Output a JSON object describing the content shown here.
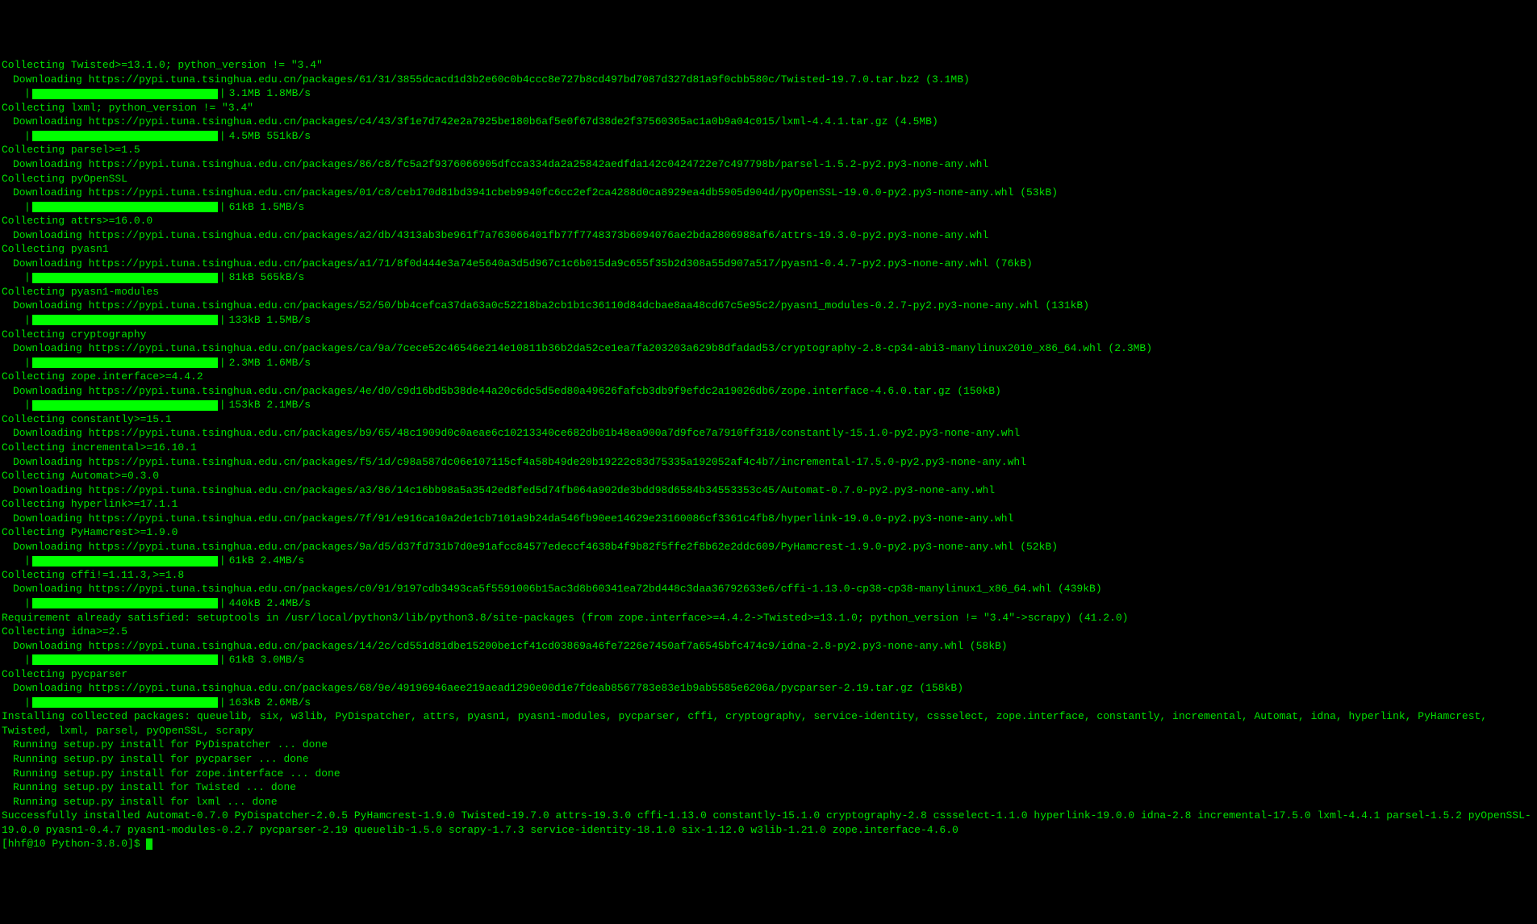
{
  "entries": [
    {
      "type": "collect",
      "text": "Collecting Twisted>=13.1.0; python_version != \"3.4\"",
      "download": "Downloading https://pypi.tuna.tsinghua.edu.cn/packages/61/31/3855dcacd1d3b2e60c0b4ccc8e727b8cd497bd7087d327d81a9f0cbb580c/Twisted-19.7.0.tar.bz2 (3.1MB)",
      "progress": "3.1MB 1.8MB/s",
      "blank_after": true
    },
    {
      "type": "collect",
      "text": "Collecting lxml; python_version != \"3.4\"",
      "download": "Downloading https://pypi.tuna.tsinghua.edu.cn/packages/c4/43/3f1e7d742e2a7925be180b6af5e0f67d38de2f37560365ac1a0b9a04c015/lxml-4.4.1.tar.gz (4.5MB)",
      "progress": "4.5MB 551kB/s"
    },
    {
      "type": "collect",
      "text": "Collecting parsel>=1.5",
      "download": "Downloading https://pypi.tuna.tsinghua.edu.cn/packages/86/c8/fc5a2f9376066905dfcca334da2a25842aedfda142c0424722e7c497798b/parsel-1.5.2-py2.py3-none-any.whl"
    },
    {
      "type": "collect",
      "text": "Collecting pyOpenSSL",
      "download": "Downloading https://pypi.tuna.tsinghua.edu.cn/packages/01/c8/ceb170d81bd3941cbeb9940fc6cc2ef2ca4288d0ca8929ea4db5905d904d/pyOpenSSL-19.0.0-py2.py3-none-any.whl (53kB)",
      "progress": "61kB 1.5MB/s"
    },
    {
      "type": "collect",
      "text": "Collecting attrs>=16.0.0",
      "download": "Downloading https://pypi.tuna.tsinghua.edu.cn/packages/a2/db/4313ab3be961f7a763066401fb77f7748373b6094076ae2bda2806988af6/attrs-19.3.0-py2.py3-none-any.whl"
    },
    {
      "type": "collect",
      "text": "Collecting pyasn1",
      "download": "Downloading https://pypi.tuna.tsinghua.edu.cn/packages/a1/71/8f0d444e3a74e5640a3d5d967c1c6b015da9c655f35b2d308a55d907a517/pyasn1-0.4.7-py2.py3-none-any.whl (76kB)",
      "progress": "81kB 565kB/s"
    },
    {
      "type": "collect",
      "text": "Collecting pyasn1-modules",
      "download": "Downloading https://pypi.tuna.tsinghua.edu.cn/packages/52/50/bb4cefca37da63a0c52218ba2cb1b1c36110d84dcbae8aa48cd67c5e95c2/pyasn1_modules-0.2.7-py2.py3-none-any.whl (131kB)",
      "progress": "133kB 1.5MB/s"
    },
    {
      "type": "collect",
      "text": "Collecting cryptography",
      "download": "Downloading https://pypi.tuna.tsinghua.edu.cn/packages/ca/9a/7cece52c46546e214e10811b36b2da52ce1ea7fa203203a629b8dfadad53/cryptography-2.8-cp34-abi3-manylinux2010_x86_64.whl (2.3MB)",
      "progress": "2.3MB 1.6MB/s"
    },
    {
      "type": "collect",
      "text": "Collecting zope.interface>=4.4.2",
      "download": "Downloading https://pypi.tuna.tsinghua.edu.cn/packages/4e/d0/c9d16bd5b38de44a20c6dc5d5ed80a49626fafcb3db9f9efdc2a19026db6/zope.interface-4.6.0.tar.gz (150kB)",
      "progress": "153kB 2.1MB/s"
    },
    {
      "type": "collect",
      "text": "Collecting constantly>=15.1",
      "download": "Downloading https://pypi.tuna.tsinghua.edu.cn/packages/b9/65/48c1909d0c0aeae6c10213340ce682db01b48ea900a7d9fce7a7910ff318/constantly-15.1.0-py2.py3-none-any.whl"
    },
    {
      "type": "collect",
      "text": "Collecting incremental>=16.10.1",
      "download": "Downloading https://pypi.tuna.tsinghua.edu.cn/packages/f5/1d/c98a587dc06e107115cf4a58b49de20b19222c83d75335a192052af4c4b7/incremental-17.5.0-py2.py3-none-any.whl"
    },
    {
      "type": "collect",
      "text": "Collecting Automat>=0.3.0",
      "download": "Downloading https://pypi.tuna.tsinghua.edu.cn/packages/a3/86/14c16bb98a5a3542ed8fed5d74fb064a902de3bdd98d6584b34553353c45/Automat-0.7.0-py2.py3-none-any.whl"
    },
    {
      "type": "collect",
      "text": "Collecting hyperlink>=17.1.1",
      "download": "Downloading https://pypi.tuna.tsinghua.edu.cn/packages/7f/91/e916ca10a2de1cb7101a9b24da546fb90ee14629e23160086cf3361c4fb8/hyperlink-19.0.0-py2.py3-none-any.whl"
    },
    {
      "type": "collect",
      "text": "Collecting PyHamcrest>=1.9.0",
      "download": "Downloading https://pypi.tuna.tsinghua.edu.cn/packages/9a/d5/d37fd731b7d0e91afcc84577edeccf4638b4f9b82f5ffe2f8b62e2ddc609/PyHamcrest-1.9.0-py2.py3-none-any.whl (52kB)",
      "progress": "61kB 2.4MB/s"
    },
    {
      "type": "collect",
      "text": "Collecting cffi!=1.11.3,>=1.8",
      "download": "Downloading https://pypi.tuna.tsinghua.edu.cn/packages/c0/91/9197cdb3493ca5f5591006b15ac3d8b60341ea72bd448c3daa36792633e6/cffi-1.13.0-cp38-cp38-manylinux1_x86_64.whl (439kB)",
      "progress": "440kB 2.4MB/s"
    },
    {
      "type": "plain",
      "text": "Requirement already satisfied: setuptools in /usr/local/python3/lib/python3.8/site-packages (from zope.interface>=4.4.2->Twisted>=13.1.0; python_version != \"3.4\"->scrapy) (41.2.0)"
    },
    {
      "type": "collect",
      "text": "Collecting idna>=2.5",
      "download": "Downloading https://pypi.tuna.tsinghua.edu.cn/packages/14/2c/cd551d81dbe15200be1cf41cd03869a46fe7226e7450af7a6545bfc474c9/idna-2.8-py2.py3-none-any.whl (58kB)",
      "progress": "61kB 3.0MB/s"
    },
    {
      "type": "collect",
      "text": "Collecting pycparser",
      "download": "Downloading https://pypi.tuna.tsinghua.edu.cn/packages/68/9e/49196946aee219aead1290e00d1e7fdeab8567783e83e1b9ab5585e6206a/pycparser-2.19.tar.gz (158kB)",
      "progress": "163kB 2.6MB/s"
    }
  ],
  "installing": "Installing collected packages: queuelib, six, w3lib, PyDispatcher, attrs, pyasn1, pyasn1-modules, pycparser, cffi, cryptography, service-identity, cssselect, zope.interface, constantly, incremental, Automat, idna, hyperlink, PyHamcrest, Twisted, lxml, parsel, pyOpenSSL, scrapy",
  "running": [
    "Running setup.py install for PyDispatcher ... done",
    "Running setup.py install for pycparser ... done",
    "Running setup.py install for zope.interface ... done",
    "Running setup.py install for Twisted ... done",
    "Running setup.py install for lxml ... done"
  ],
  "success": "Successfully installed Automat-0.7.0 PyDispatcher-2.0.5 PyHamcrest-1.9.0 Twisted-19.7.0 attrs-19.3.0 cffi-1.13.0 constantly-15.1.0 cryptography-2.8 cssselect-1.1.0 hyperlink-19.0.0 idna-2.8 incremental-17.5.0 lxml-4.4.1 parsel-1.5.2 pyOpenSSL-19.0.0 pyasn1-0.4.7 pyasn1-modules-0.2.7 pycparser-2.19 queuelib-1.5.0 scrapy-1.7.3 service-identity-18.1.0 six-1.12.0 w3lib-1.21.0 zope.interface-4.6.0",
  "prompt": "[hhf@10 Python-3.8.0]$ "
}
